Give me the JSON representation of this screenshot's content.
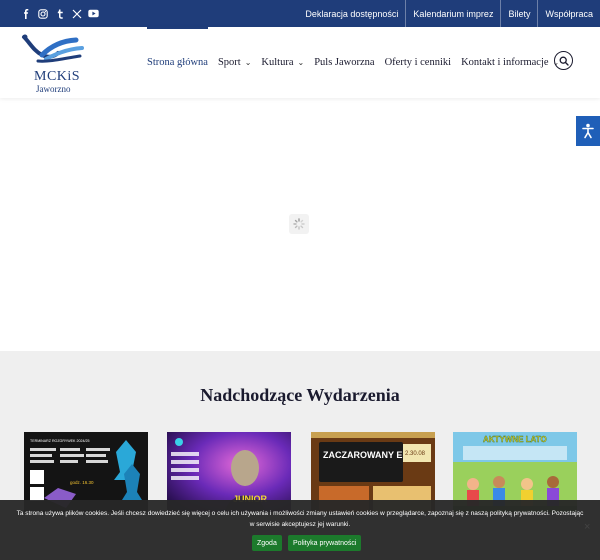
{
  "topbar": {
    "social_icons": [
      "facebook-icon",
      "instagram-icon",
      "tumblr-icon",
      "x-icon",
      "youtube-icon"
    ],
    "links": [
      "Deklaracja dostępności",
      "Kalendarium imprez",
      "Bilety",
      "Współpraca"
    ]
  },
  "header": {
    "logo_text": "MCKiS",
    "logo_subtext": "Jaworzno",
    "nav": [
      {
        "label": "Strona główna",
        "has_dropdown": false
      },
      {
        "label": "Sport",
        "has_dropdown": true
      },
      {
        "label": "Kultura",
        "has_dropdown": true
      },
      {
        "label": "Puls Jaworzna",
        "has_dropdown": false
      },
      {
        "label": "Oferty i cenniki",
        "has_dropdown": false
      },
      {
        "label": "Kontakt i informacje",
        "has_dropdown": true
      }
    ]
  },
  "events": {
    "title": "Nadchodzące Wydarzenia",
    "cards": [
      {
        "text": "TERMINARZ ROZGRYWEK 2024/25",
        "extra": "godz. 16.30"
      },
      {
        "text": "JUNIOR"
      },
      {
        "text": "ZACZAROWANY EKRAN",
        "extra": "2.30.08"
      },
      {
        "text": "AKTYWNE LATO"
      }
    ]
  },
  "cookie": {
    "text": "Ta strona używa plików cookies. Jeśli chcesz dowiedzieć się więcej o celu ich używania i możliwości zmiany ustawień cookies w przeglądarce, zapoznaj się z naszą polityką prywatności. Pozostając w serwisie akceptujesz jej warunki.",
    "accept_label": "Zgoda",
    "privacy_label": "Polityka prywatności",
    "close_label": "×"
  },
  "colors": {
    "brand_blue": "#1f3d7a",
    "cookie_green": "#1c7a2c",
    "a11y_blue": "#1f5fb8"
  }
}
